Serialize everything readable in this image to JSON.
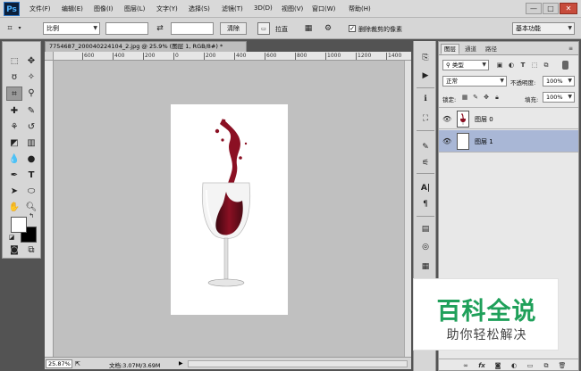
{
  "app": {
    "logo": "Ps",
    "menu": [
      "文件(F)",
      "编辑(E)",
      "图像(I)",
      "图层(L)",
      "文字(Y)",
      "选择(S)",
      "滤镜(T)",
      "3D(D)",
      "视图(V)",
      "窗口(W)",
      "帮助(H)"
    ],
    "window_buttons": [
      "—",
      "□",
      "✕"
    ]
  },
  "options_bar": {
    "ratio_select": "比例",
    "clear_button": "清除",
    "straighten_button": "拉直",
    "delete_cropped_label": "删除裁剪的像素",
    "delete_cropped_checked": true,
    "workspace": "基本功能"
  },
  "document": {
    "tab_title": "7754687_200040224104_2.jpg @ 25.9% (图层 1, RGB/8#) *",
    "ruler_ticks": [
      "600",
      "400",
      "200",
      "0",
      "200",
      "400",
      "600",
      "800",
      "1000",
      "1200",
      "1400"
    ],
    "zoom": "25.87%",
    "status": "文档:3.07M/3.69M"
  },
  "layers_panel": {
    "tabs": [
      "图层",
      "通道",
      "路径"
    ],
    "filter_select": "类型",
    "blend_mode": "正常",
    "opacity_label": "不透明度:",
    "opacity_value": "100%",
    "lock_label": "锁定:",
    "fill_label": "填充:",
    "fill_value": "100%",
    "layers": [
      {
        "name": "图层 0",
        "selected": false
      },
      {
        "name": "图层 1",
        "selected": true
      }
    ]
  },
  "watermark": {
    "title": "百科全说",
    "subtitle": "助你轻松解决"
  }
}
